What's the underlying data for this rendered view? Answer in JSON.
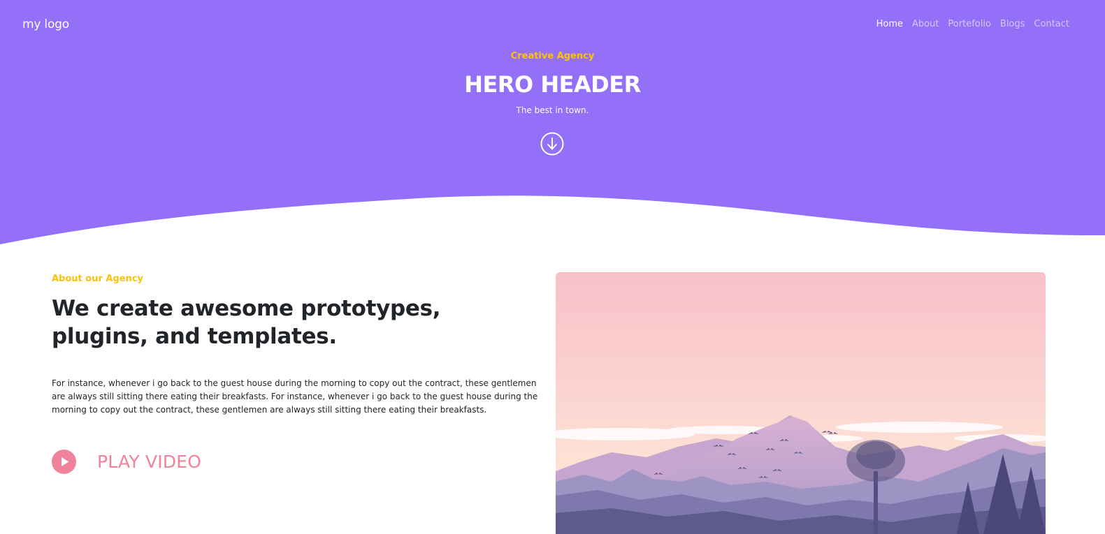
{
  "colors": {
    "hero_bg": "#9370f7",
    "accent": "#ffc107",
    "play_pink": "#f1829c"
  },
  "nav": {
    "logo": "my logo",
    "items": [
      {
        "label": "Home",
        "active": true
      },
      {
        "label": "About",
        "active": false
      },
      {
        "label": "Portefolio",
        "active": false
      },
      {
        "label": "Blogs",
        "active": false
      },
      {
        "label": "Contact",
        "active": false
      }
    ]
  },
  "hero": {
    "eyebrow": "Creative Agency",
    "title": "HERO HEADER",
    "subtitle": "The best in town.",
    "scroll_icon": "arrow-down-circle-icon"
  },
  "about": {
    "label": "About our Agency",
    "title": "We create awesome prototypes, plugins, and templates.",
    "text": "For instance, whenever i go back to the guest house during the morning to copy out the contract, these gentlemen are always still sitting there eating their breakfasts. For instance, whenever i go back to the guest house during the morning to copy out the contract, these gentlemen are always still sitting there eating their breakfasts.",
    "play_label": "PLAY VIDEO",
    "play_icon": "play-circle-icon"
  }
}
